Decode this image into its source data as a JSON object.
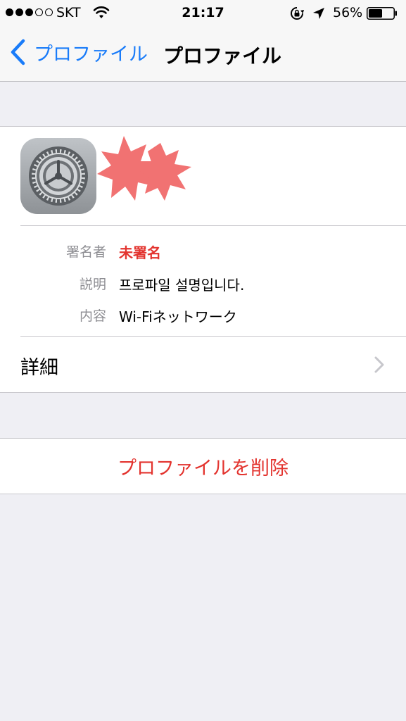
{
  "status_bar": {
    "carrier": "SKT",
    "time": "21:17",
    "battery_percent": "56%",
    "battery_level": 0.56,
    "signal_bars_filled": 3,
    "signal_bars_total": 5
  },
  "nav": {
    "back_label": "プロファイル",
    "title": "プロファイル"
  },
  "profile": {
    "icon": "settings-gear-icon",
    "rows": [
      {
        "label": "署名者",
        "value": "未署名"
      },
      {
        "label": "説明",
        "value": "프로파일 설명입니다."
      },
      {
        "label": "内容",
        "value": "Wi-Fiネットワーク"
      }
    ],
    "details_label": "詳細"
  },
  "actions": {
    "delete_label": "プロファイルを削除"
  },
  "colors": {
    "accent": "#1a7cf9",
    "destructive": "#e3342f",
    "background": "#efeff4",
    "secondary_text": "#8e8e93"
  }
}
